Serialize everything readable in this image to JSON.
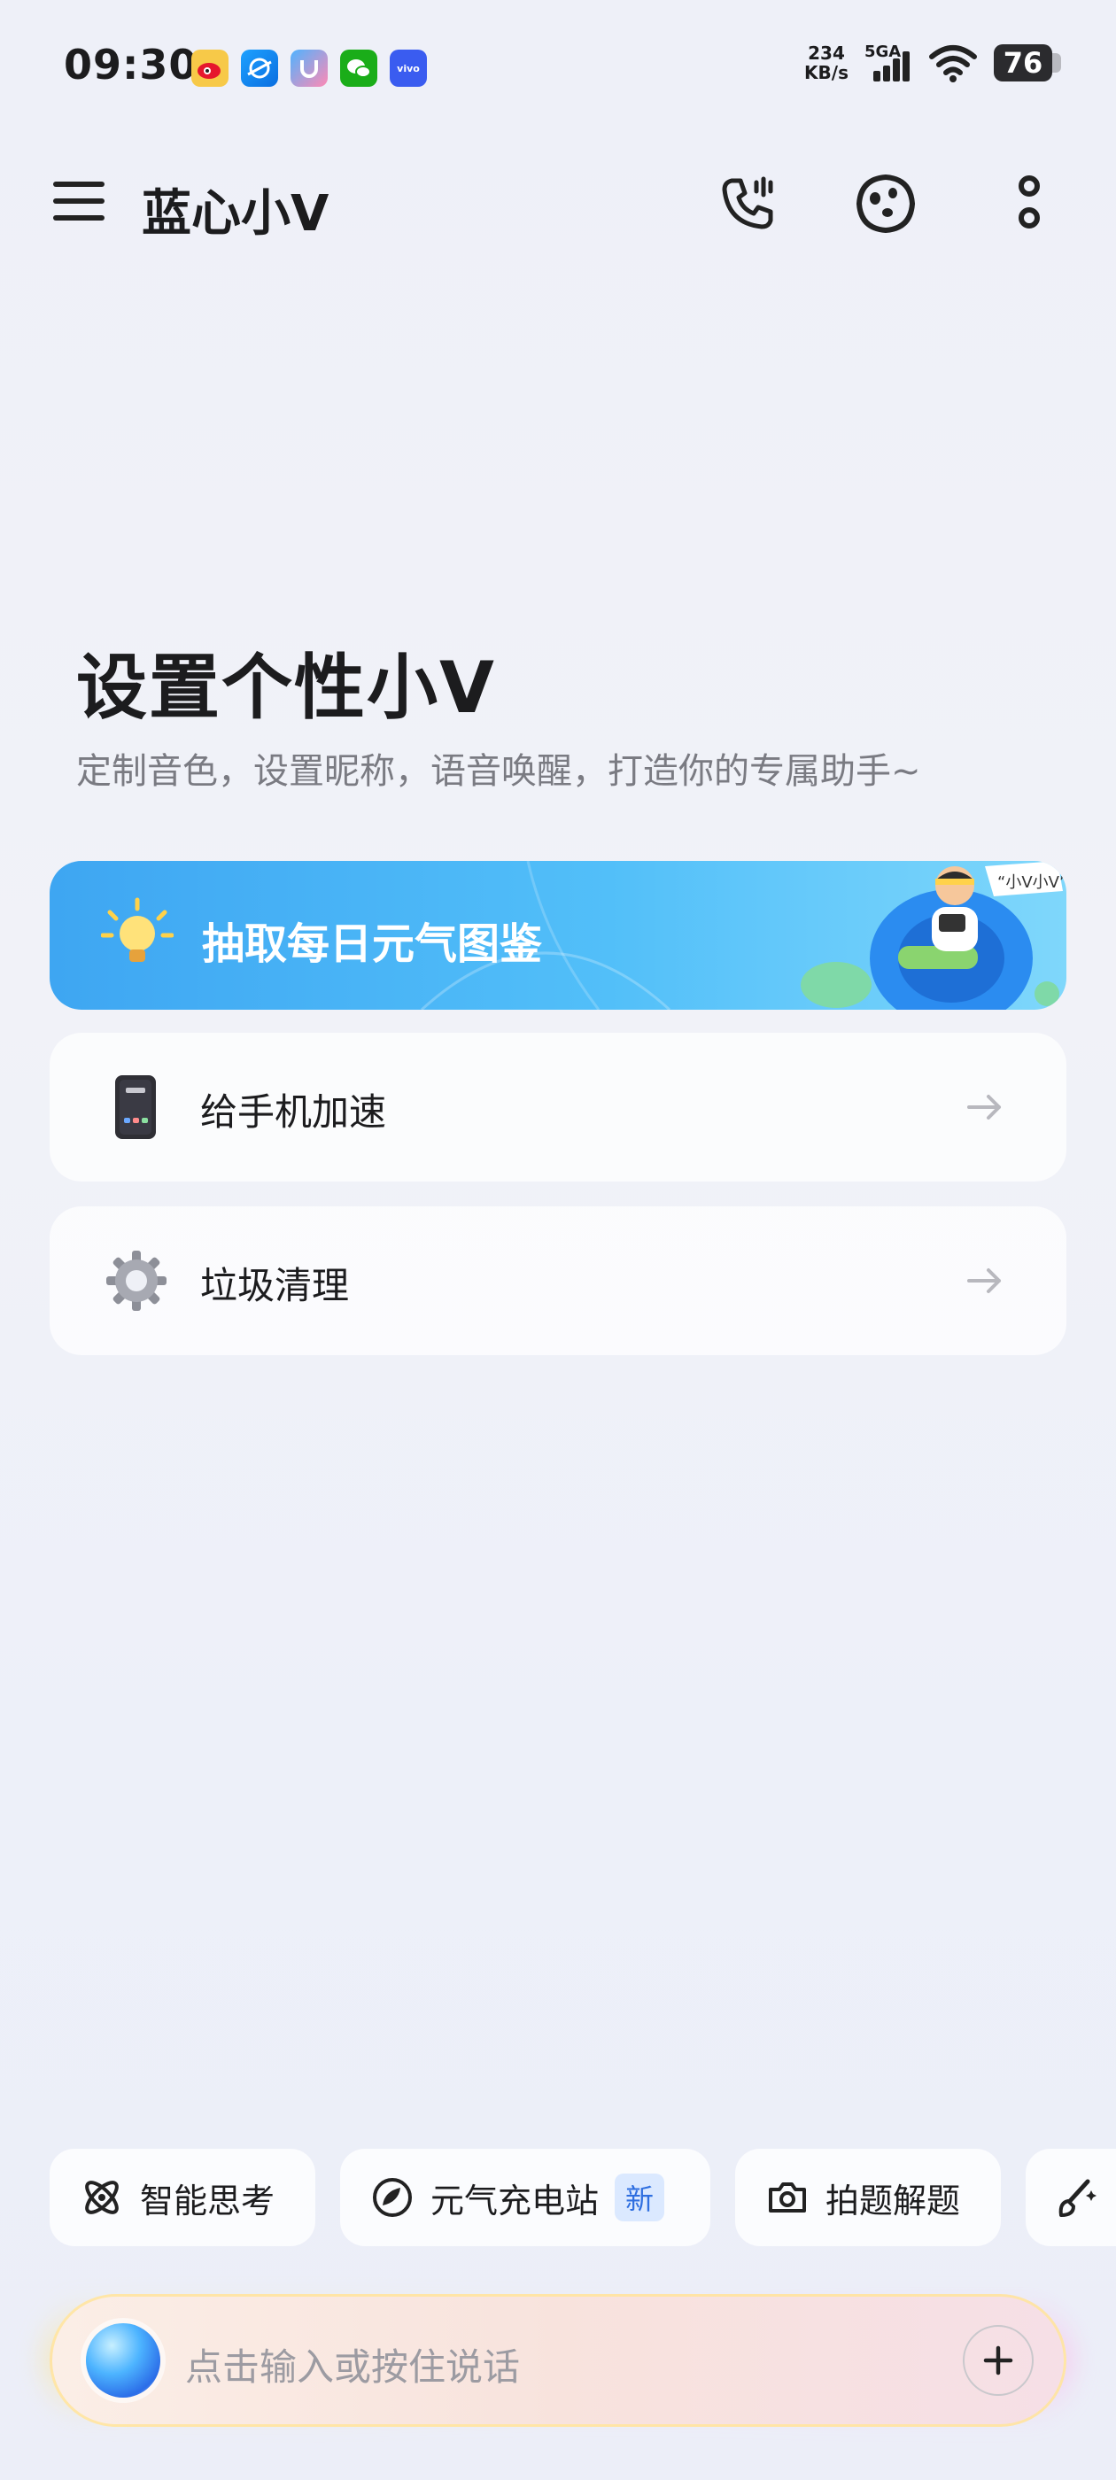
{
  "status_bar": {
    "time": "09:30",
    "net_speed_value": "234",
    "net_speed_unit": "KB/s",
    "network": "5GA",
    "battery": "76"
  },
  "header": {
    "title": "蓝心小V",
    "icons": [
      "menu-icon",
      "phone-call-icon",
      "assistant-face-icon",
      "more-vertical-icon"
    ]
  },
  "hero": {
    "title": "设置个性小V",
    "subtitle": "定制音色，设置昵称，语音唤醒，打造你的专属助手~"
  },
  "banner": {
    "label": "抽取每日元气图鉴",
    "bubble_text": "“小V小V”"
  },
  "cards": [
    {
      "label": "给手机加速",
      "icon": "phone-icon"
    },
    {
      "label": "垃圾清理",
      "icon": "gear-icon"
    }
  ],
  "chips": [
    {
      "label": "智能思考",
      "icon": "atom-icon"
    },
    {
      "label": "元气充电站",
      "icon": "charge-icon",
      "badge": "新"
    },
    {
      "label": "拍题解题",
      "icon": "camera-icon"
    },
    {
      "label": "",
      "icon": "paint-brush-icon"
    }
  ],
  "input": {
    "placeholder": "点击输入或按住说话"
  },
  "colors": {
    "banner_start": "#3ea6f2",
    "banner_end": "#7fd7fb",
    "badge_text": "#2f6fe0"
  }
}
